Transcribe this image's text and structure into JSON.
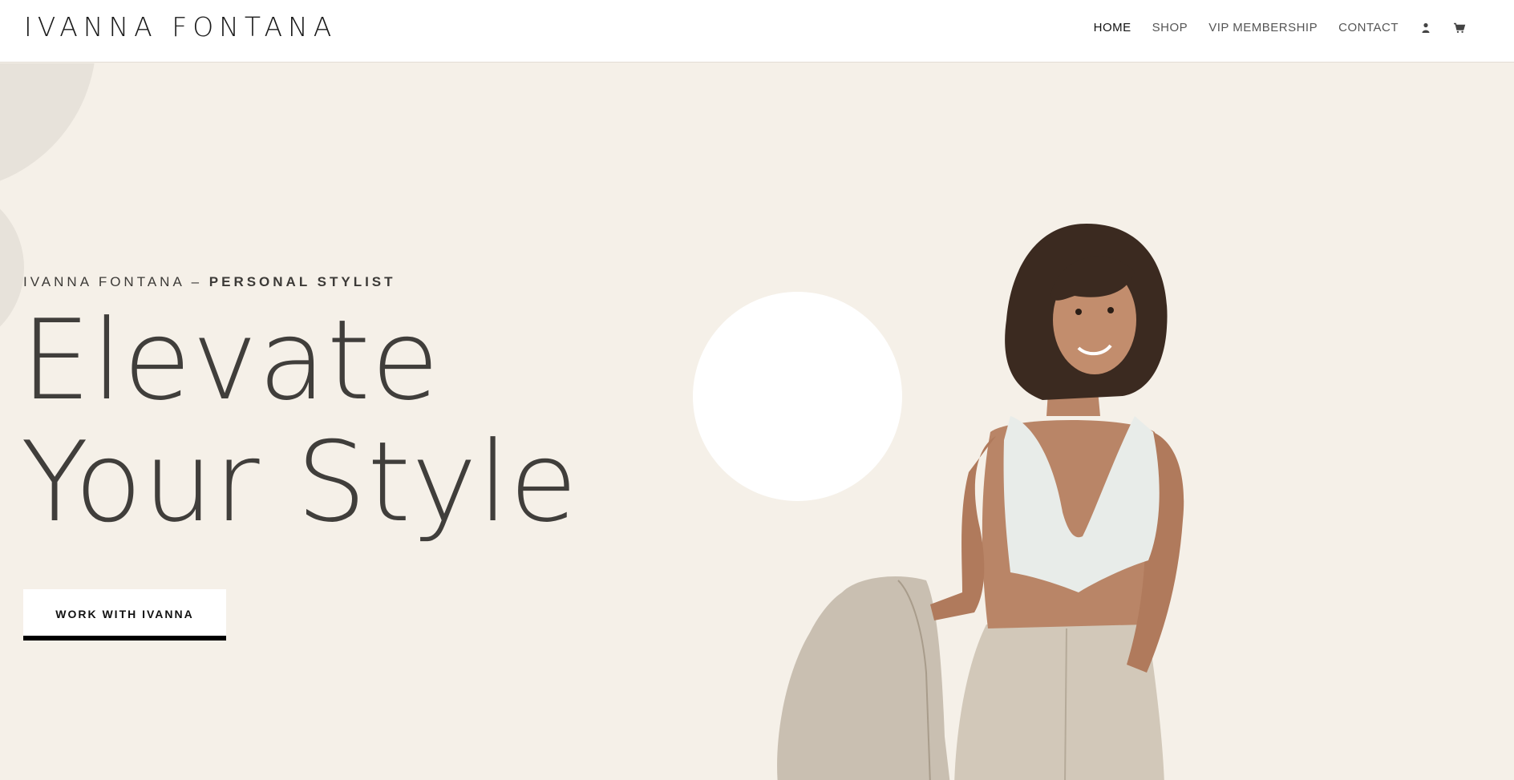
{
  "brand": {
    "logo_text": "IVANNA FONTANA"
  },
  "nav": {
    "items": [
      {
        "label": "HOME"
      },
      {
        "label": "SHOP"
      },
      {
        "label": "VIP MEMBERSHIP"
      },
      {
        "label": "CONTACT"
      }
    ],
    "icons": [
      "user-icon",
      "cart-icon"
    ]
  },
  "hero": {
    "tagline_prefix": "IVANNA FONTANA –",
    "tagline_bold": "PERSONAL STYLIST",
    "headline_line1": "Elevate",
    "headline_line2": "Your Style",
    "cta_label": "WORK WITH IVANNA"
  },
  "colors": {
    "background": "#f5f0e8",
    "header": "#ffffff",
    "text": "#403e3b",
    "accent": "#000000"
  }
}
